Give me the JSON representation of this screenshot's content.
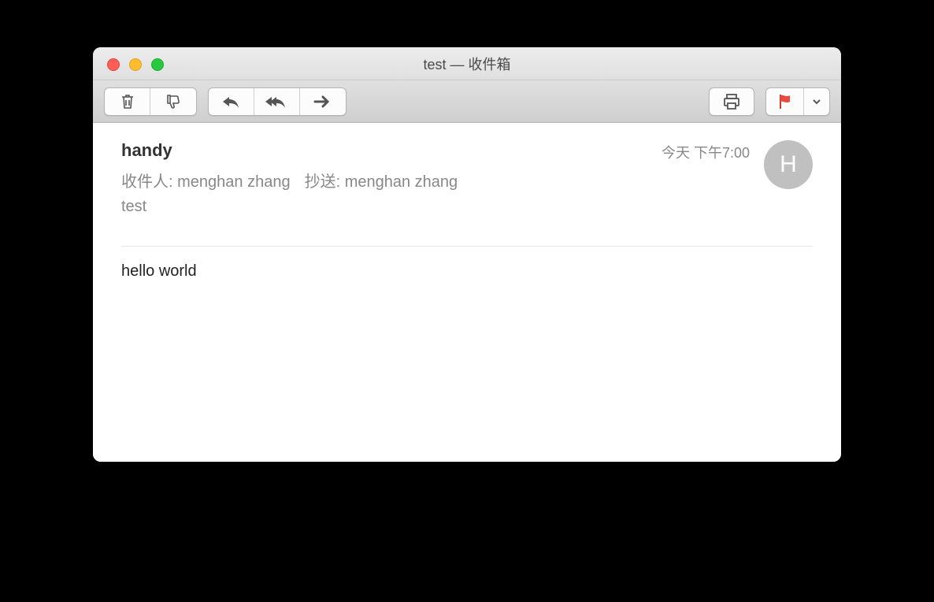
{
  "window": {
    "title": "test — 收件箱"
  },
  "toolbar": {
    "delete_icon": "trash",
    "junk_icon": "thumbs-down",
    "reply_icon": "reply",
    "reply_all_icon": "reply-all",
    "forward_icon": "forward",
    "print_icon": "print",
    "flag_icon": "flag",
    "dropdown_icon": "chevron-down"
  },
  "message": {
    "sender": "handy",
    "timestamp": "今天 下午7:00",
    "to_label": "收件人:",
    "to_value": "menghan zhang",
    "cc_label": "抄送:",
    "cc_value": "menghan zhang",
    "subject": "test",
    "avatar_initial": "H",
    "body": "hello world"
  }
}
